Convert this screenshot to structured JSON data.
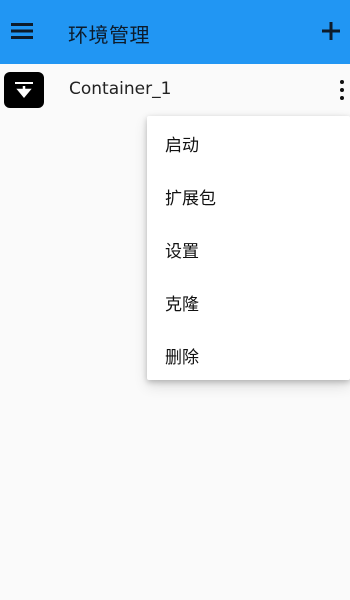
{
  "appbar": {
    "title": "环境管理",
    "menu_icon": "hamburger-menu-icon",
    "add_icon": "plus-icon",
    "color": "#2196f3"
  },
  "container_row": {
    "icon": "archive-download-icon",
    "label": "Container_1",
    "more_icon": "more-vertical-icon"
  },
  "popup_menu": {
    "items": [
      {
        "label": "启动"
      },
      {
        "label": "扩展包"
      },
      {
        "label": "设置"
      },
      {
        "label": "克隆"
      },
      {
        "label": "删除"
      }
    ]
  }
}
